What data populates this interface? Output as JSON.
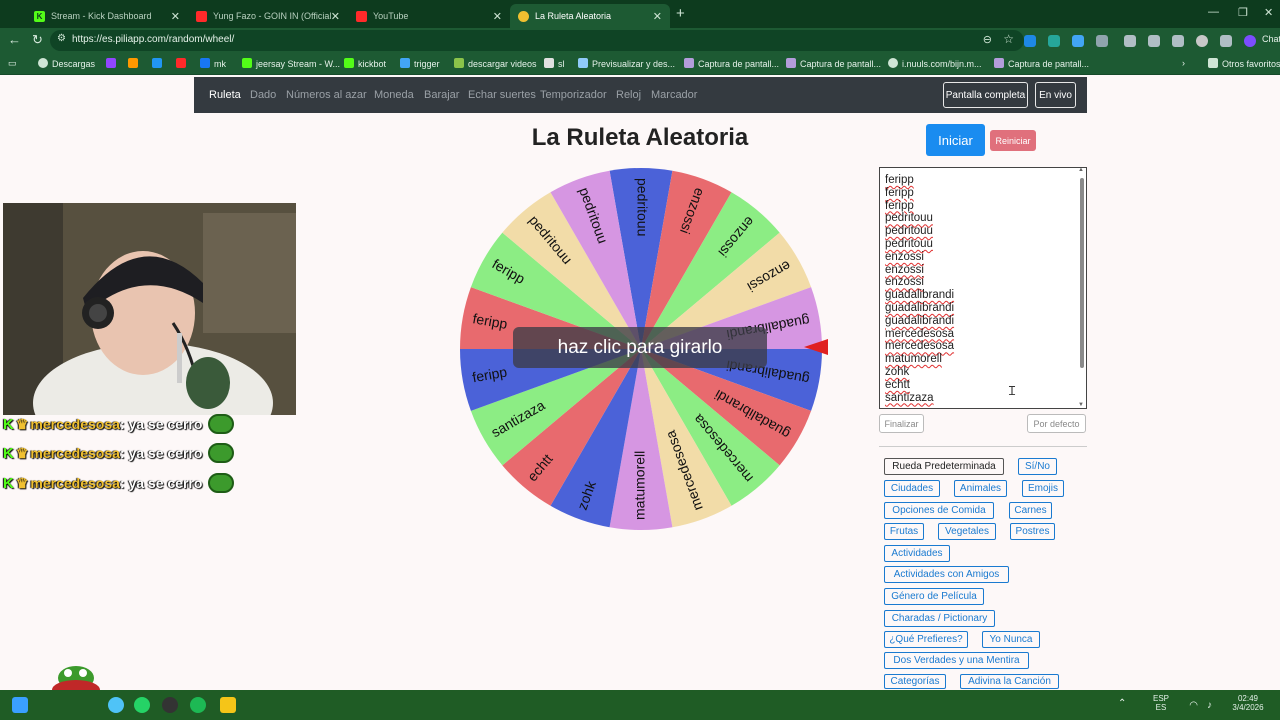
{
  "browser": {
    "tabs": [
      {
        "label": "Stream - Kick Dashboard",
        "icon": "kick-icon",
        "color": "#53fc18"
      },
      {
        "label": "Yung Fazo - GOIN IN (Official Vide",
        "icon": "youtube-icon",
        "color": "#ff2a2a"
      },
      {
        "label": "YouTube",
        "icon": "youtube-icon",
        "color": "#ff2a2a"
      },
      {
        "label": "La Ruleta Aleatoria",
        "icon": "wheel-icon",
        "color": "#f0c030",
        "active": true
      }
    ],
    "new_tab": "+",
    "url": "https://es.piliapp.com/random/wheel/",
    "bookmarks": [
      "Descargas",
      "mk",
      "jeersay Stream - W...",
      "kickbot",
      "trigger",
      "descargar videos",
      "sl",
      "Previsualizar y des...",
      "Captura de pantall...",
      "Captura de pantall...",
      "i.nuuls.com/bijn.m...",
      "Captura de pantall..."
    ],
    "other_bookmarks": "Otros favoritos",
    "chat_label": "Chat"
  },
  "site_nav": {
    "links": [
      "Ruleta",
      "Dado",
      "Números al azar",
      "Moneda",
      "Barajar",
      "Echar suertes",
      "Temporizador",
      "Reloj",
      "Marcador"
    ],
    "fullscreen": "Pantalla completa",
    "live": "En vivo"
  },
  "title": "La Ruleta Aleatoria",
  "spin_prompt": "haz clic para girarlo",
  "buttons": {
    "start": "Iniciar",
    "reset": "Reiniciar",
    "finish": "Finalizar",
    "default": "Por defecto"
  },
  "entries": [
    "feripp",
    "feripp",
    "feripp",
    "pedritouu",
    "pedritouu",
    "pedritouu",
    "enzossi",
    "enzossi",
    "enzossi",
    "guadalibrandi",
    "guadalibrandi",
    "guadalibrandi",
    "mercedesosa",
    "mercedesosa",
    "matumorell",
    "zohk",
    "echtt",
    "santizaza"
  ],
  "wheel": {
    "segments": [
      {
        "label": "pedritouu",
        "color": "#4b62d8"
      },
      {
        "label": "enzossi",
        "color": "#e86a6e"
      },
      {
        "label": "enzossi",
        "color": "#8ced84"
      },
      {
        "label": "enzossi",
        "color": "#f2dca8"
      },
      {
        "label": "guadalibrandi",
        "color": "#d696e2"
      },
      {
        "label": "guadalibrandi",
        "color": "#4b62d8"
      },
      {
        "label": "guadalibrandi",
        "color": "#e86a6e"
      },
      {
        "label": "mercedesosa",
        "color": "#8ced84"
      },
      {
        "label": "mercedesosa",
        "color": "#f2dca8"
      },
      {
        "label": "matumorell",
        "color": "#d696e2"
      },
      {
        "label": "zohk",
        "color": "#4b62d8"
      },
      {
        "label": "echtt",
        "color": "#e86a6e"
      },
      {
        "label": "santizaza",
        "color": "#8ced84"
      },
      {
        "label": "feripp",
        "color": "#4b62d8"
      },
      {
        "label": "feripp",
        "color": "#e86a6e"
      },
      {
        "label": "feripp",
        "color": "#8ced84"
      },
      {
        "label": "pedritouu",
        "color": "#f2dca8"
      },
      {
        "label": "pedritouu",
        "color": "#d696e2"
      }
    ]
  },
  "presets": [
    "Rueda Predeterminada",
    "Sí/No",
    "Ciudades",
    "Animales",
    "Emojis",
    "Opciones de Comida",
    "Carnes",
    "Frutas",
    "Vegetales",
    "Postres",
    "Actividades",
    "Actividades con Amigos",
    "Género de Película",
    "Charadas / Pictionary",
    "¿Qué Prefieres?",
    "Yo Nunca",
    "Dos Verdades y una Mentira",
    "Categorías",
    "Adivina la Canción"
  ],
  "chat": [
    {
      "user": "mercedesosa",
      "message": ": ya se cerro"
    },
    {
      "user": "mercedesosa",
      "message": ": ya se cerro"
    },
    {
      "user": "mercedesosa",
      "message": ": ya se cerro"
    }
  ],
  "taskbar": {
    "lang_top": "ESP",
    "lang_bottom": "ES",
    "time": "02:49",
    "date": "3/4/2026"
  }
}
